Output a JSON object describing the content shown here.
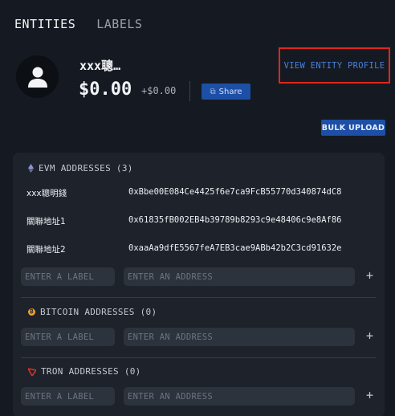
{
  "tabs": [
    {
      "label": "ENTITIES",
      "active": true
    },
    {
      "label": "LABELS",
      "active": false
    }
  ],
  "entity": {
    "name": "xxx聰…",
    "balance": "$0.00",
    "delta": "+$0.00",
    "share_label": "Share",
    "view_profile_label": "VIEW ENTITY PROFILE"
  },
  "bulk_upload_label": "BULK UPLOAD",
  "sections": {
    "evm": {
      "title": "EVM ADDRESSES (3)",
      "icon": "ethereum-icon",
      "rows": [
        {
          "label": "xxx聰明錢",
          "address": "0xBbe00E084Ce4425f6e7ca9FcB55770d340874dC8"
        },
        {
          "label": "關聯地址1",
          "address": "0x61835fB002EB4b39789b8293c9e48406c9e8Af86"
        },
        {
          "label": "關聯地址2",
          "address": "0xaaAa9dfE5567feA7EB3cae9ABb42b2C3cd91632e"
        }
      ]
    },
    "bitcoin": {
      "title": "BITCOIN ADDRESSES (0)",
      "icon": "bitcoin-icon"
    },
    "tron": {
      "title": "TRON ADDRESSES (0)",
      "icon": "tron-icon"
    }
  },
  "inputs": {
    "label_placeholder": "ENTER A LABEL",
    "address_placeholder": "ENTER AN ADDRESS",
    "add_symbol": "+"
  },
  "colors": {
    "background": "#151a22",
    "panel": "#1d222b",
    "accent_blue": "#1d4fa6",
    "link_blue": "#4a7fe0",
    "highlight_red": "#e0261e",
    "bitcoin_orange": "#f2a12c",
    "tron_red": "#d8312b"
  }
}
